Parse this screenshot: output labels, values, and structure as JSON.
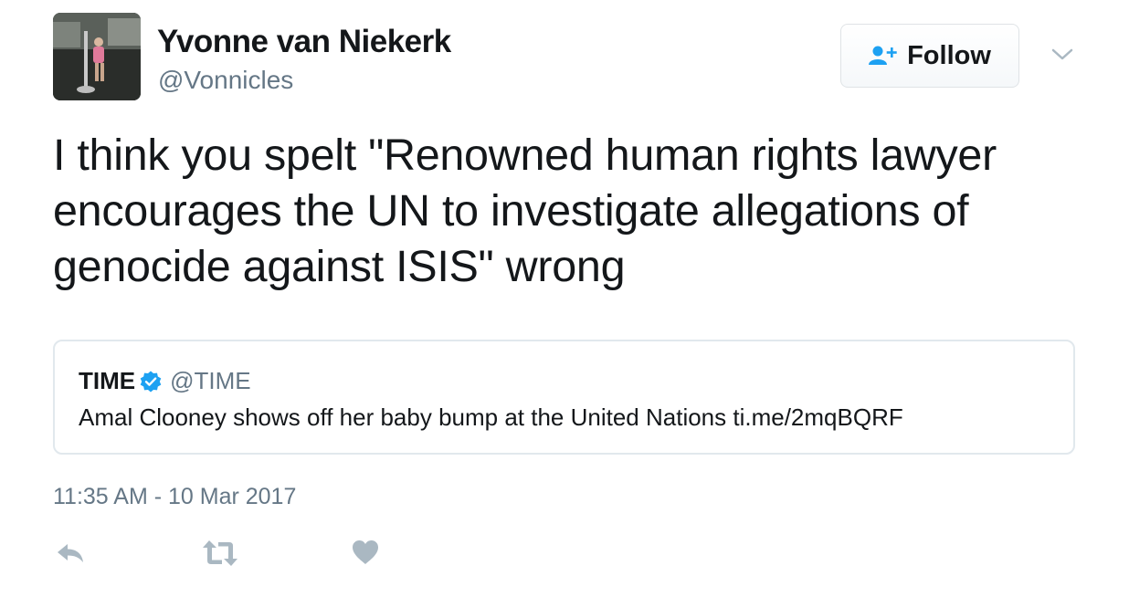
{
  "author": {
    "display_name": "Yvonne van Niekerk",
    "screen_name": "@Vonnicles",
    "avatar": "profile-photo"
  },
  "follow_button": {
    "label": "Follow",
    "icon": "add-user-icon"
  },
  "menu": {
    "icon": "chevron-down-icon"
  },
  "tweet": {
    "text": "I think you spelt \"Renowned human rights lawyer encourages the UN to investigate allegations of genocide against ISIS\" wrong",
    "timestamp": "11:35 AM - 10 Mar 2017"
  },
  "quoted_tweet": {
    "name": "TIME",
    "handle": "@TIME",
    "verified_icon": "verified-badge-icon",
    "text": "Amal Clooney shows off her baby bump at the United Nations ti.me/2mqBQRF"
  },
  "actions": [
    {
      "icon": "reply-icon"
    },
    {
      "icon": "retweet-icon"
    },
    {
      "icon": "like-heart-icon"
    }
  ],
  "colors": {
    "text_primary": "#14171a",
    "text_secondary": "#657786",
    "brand_blue": "#1da1f2",
    "action_gray": "#aab8c2",
    "border": "#e1e8ed"
  }
}
